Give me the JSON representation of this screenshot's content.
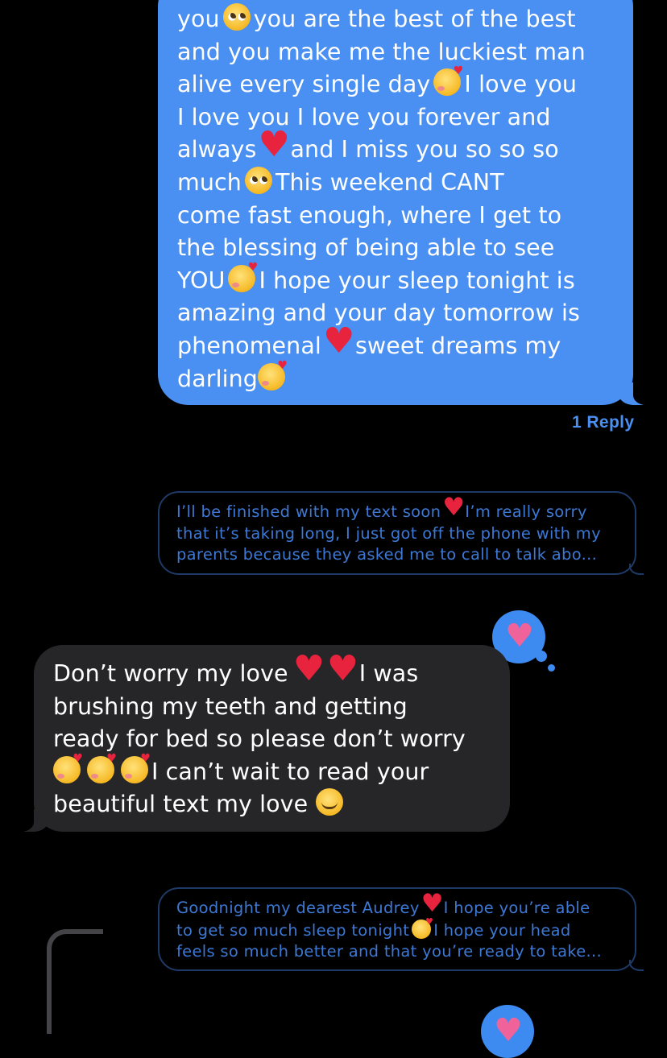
{
  "colors": {
    "background": "#000000",
    "outgoing_bubble": "#4a8ff2",
    "incoming_bubble": "#262628",
    "reply_text": "#3d78d4",
    "tapback": "#3d8bf0",
    "tapback_heart": "#f0639a"
  },
  "outgoing_message": {
    "lines": [
      {
        "a": "you",
        "e": "pleading-face-emoji",
        "b": "you are the best of the best"
      },
      {
        "a": "and you make me the luckiest man"
      },
      {
        "a": "alive every single day",
        "e": "smiling-face-with-hearts-emoji",
        "b": "I love you"
      },
      {
        "a": "I love you I love you forever and"
      },
      {
        "a": "always",
        "e": "red-heart-emoji",
        "b": "and I miss you so so so"
      },
      {
        "a": "much",
        "e": "pleading-face-emoji",
        "b": "This weekend CANT"
      },
      {
        "a": "come fast enough, where I get to"
      },
      {
        "a": "the blessing of being able to see"
      },
      {
        "a": "YOU",
        "e": "smiling-face-with-hearts-emoji",
        "b": "I hope your sleep tonight is"
      },
      {
        "a": "amazing and your day tomorrow is"
      },
      {
        "a": "phenomenal",
        "e": "red-heart-emoji",
        "b": "sweet dreams my"
      },
      {
        "a": "darling",
        "e": "smiling-face-with-hearts-emoji"
      }
    ],
    "reply_count": "1 Reply"
  },
  "reply_preview_1": {
    "lines": [
      {
        "a": "I’ll be finished with my text soon",
        "e": "red-heart-emoji",
        "b": "I’m really sorry"
      },
      {
        "a": "that it’s taking long, I just got off the phone with my"
      },
      {
        "a": "parents because they asked me to call to talk abo..."
      }
    ]
  },
  "incoming_message": {
    "lines": [
      {
        "a": "Don’t worry my love",
        "e": "red-heart-emoji",
        "e2": "red-heart-emoji",
        "b": "I was"
      },
      {
        "a": "brushing my teeth and getting"
      },
      {
        "a": "ready for bed so please don’t worry"
      },
      {
        "e": "smiling-face-with-hearts-emoji",
        "e2": "smiling-face-with-hearts-emoji",
        "e3": "smiling-face-with-hearts-emoji",
        "b": "I can’t wait to read your"
      },
      {
        "a": "beautiful text my love",
        "e": "smiling-face-emoji"
      }
    ],
    "tapback": "heart-tapback-icon"
  },
  "reply_preview_2": {
    "lines": [
      {
        "a": "Goodnight my dearest Audrey",
        "e": "red-heart-emoji",
        "b": "I hope you’re able"
      },
      {
        "a": "to get so much sleep tonight",
        "e": "smiling-face-with-hearts-emoji",
        "b": "I hope your head"
      },
      {
        "a": "feels so much better and that you’re ready to take..."
      }
    ]
  }
}
